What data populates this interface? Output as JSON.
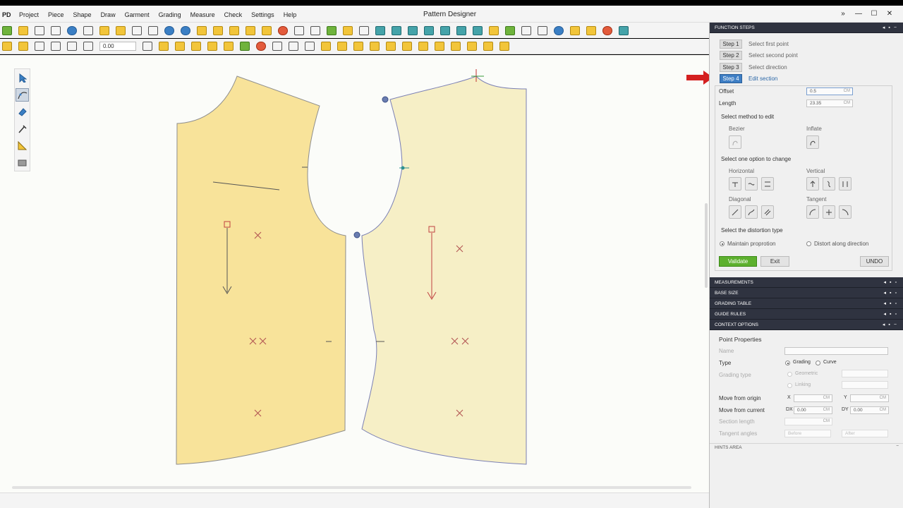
{
  "app": {
    "logo": "PD",
    "title": "Pattern Designer",
    "menu": [
      "Project",
      "Piece",
      "Shape",
      "Draw",
      "Garment",
      "Grading",
      "Measure",
      "Check",
      "Settings",
      "Help"
    ],
    "window_controls": [
      "»",
      "—",
      "☐",
      "✕"
    ]
  },
  "toolbar2": {
    "value": "0.00"
  },
  "function_steps": {
    "header": "FUNCTION STEPS",
    "steps": [
      {
        "label": "Step 1",
        "text": "Select first point"
      },
      {
        "label": "Step 2",
        "text": "Select second point"
      },
      {
        "label": "Step 3",
        "text": "Select direction"
      },
      {
        "label": "Step 4",
        "text": "Edit section",
        "active": true
      }
    ],
    "offset_label": "Offset",
    "offset_value": "0.5",
    "length_label": "Length",
    "length_value": "23.35",
    "unit": "CM",
    "method_title": "Select method to edit",
    "bezier": "Bezier",
    "inflate": "Inflate",
    "option_title": "Select one option to change",
    "horizontal": "Horizontal",
    "vertical": "Vertical",
    "diagonal": "Diagonal",
    "tangent": "Tangent",
    "distortion_title": "Select the distortion type",
    "maintain": "Maintain proprotion",
    "distort_along": "Distort along direction",
    "validate": "Validate",
    "exit": "Exit",
    "undo": "UNDO"
  },
  "panels": [
    "MEASUREMENTS",
    "BASE SIZE",
    "GRADING TABLE",
    "GUIDE RULES",
    "CONTEXT OPTIONS"
  ],
  "context": {
    "title": "Point Properties",
    "name_label": "Name",
    "type_label": "Type",
    "grading": "Grading",
    "curve": "Curve",
    "grading_type_label": "Grading type",
    "geometric": "Geometric",
    "linking": "Linking",
    "move_origin_label": "Move from origin",
    "move_current_label": "Move from current",
    "x": "X",
    "y": "Y",
    "dx": "DX",
    "dy": "DY",
    "dx_value": "0.00",
    "dy_value": "0.00",
    "section_length_label": "Section length",
    "tangent_angles_label": "Tangent angles",
    "before": "Before",
    "after": "After",
    "unit": "CM"
  },
  "hints_area": "HINTS AREA",
  "colors": {
    "piece_left": "#f8e39a",
    "piece_right": "#f6efc6",
    "panel_header": "#2f3340",
    "step_active": "#3e7ec4",
    "validate": "#5db02e",
    "arrow": "#d42020"
  }
}
